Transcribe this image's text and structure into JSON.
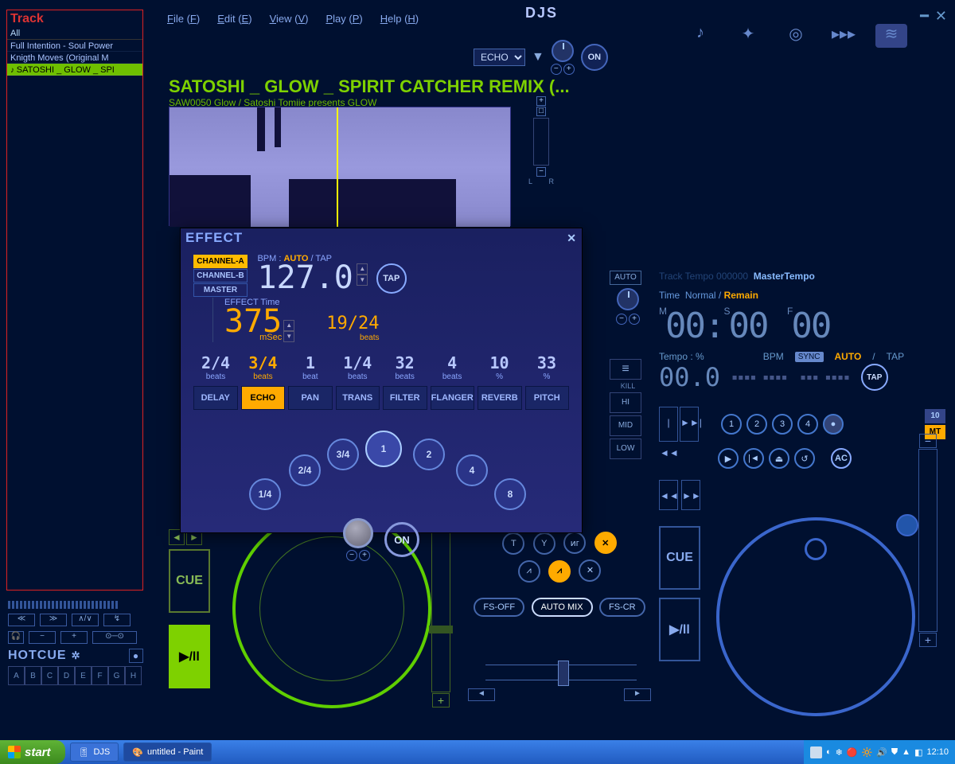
{
  "app_title": "DJS",
  "menus": {
    "file": "File (F)",
    "edit": "Edit (E)",
    "view": "View (V)",
    "play": "Play (P)",
    "help": "Help (H)"
  },
  "top_effect": {
    "selected": "ECHO",
    "on": "ON"
  },
  "track_panel": {
    "header": "Track",
    "filter": "All",
    "items": [
      "Full Intention - Soul Power",
      "Knigth Moves (Original M",
      "SATOSHI _ GLOW _ SPI"
    ],
    "selected_index": 2
  },
  "now_playing": {
    "title": "SATOSHI _ GLOW _ SPIRIT CATCHER REMIX (...",
    "subtitle": "SAW0050 Glow / Satoshi Tomiie presents GLOW"
  },
  "vol": {
    "l": "L",
    "r": "R"
  },
  "hotcue": {
    "label": "HOTCUE",
    "cells": [
      "A",
      "B",
      "C",
      "D",
      "E",
      "F",
      "G",
      "H"
    ]
  },
  "effect_modal": {
    "title": "EFFECT",
    "channels": [
      "CHANNEL-A",
      "CHANNEL-B",
      "MASTER"
    ],
    "channel_active": 0,
    "bpm_label_prefix": "BPM : ",
    "auto": "AUTO",
    "tap": "TAP",
    "bpm_value": "127.0",
    "time_label": "EFFECT Time",
    "time_value": "375",
    "time_unit": "mSec",
    "beats_ind": "19/24",
    "beats_unit": "beats",
    "beat_row_values": [
      "2/4",
      "3/4",
      "1",
      "1/4",
      "32",
      "4",
      "10",
      "33"
    ],
    "beat_row_units": [
      "beats",
      "beats",
      "beat",
      "beats",
      "beats",
      "beats",
      "%",
      "%"
    ],
    "beat_row_active": 1,
    "fx": [
      "DELAY",
      "ECHO",
      "PAN",
      "TRANS",
      "FILTER",
      "FLANGER",
      "REVERB",
      "PITCH"
    ],
    "fx_active": 1,
    "arc": [
      "1/4",
      "2/4",
      "3/4",
      "1",
      "2",
      "4",
      "8"
    ],
    "arc_selected": 3,
    "on": "ON"
  },
  "deck_a": {
    "cue": "CUE",
    "play": "▶/ll"
  },
  "mixer": {
    "row1": [
      "T",
      "Y",
      "ͷг",
      "✕"
    ],
    "row2": [
      "⩘",
      "⩘",
      "✕"
    ],
    "row2_active": 1,
    "fs_off": "FS-OFF",
    "automix": "AUTO MIX",
    "fs_cr": "FS-CR",
    "left_arrow": "◄",
    "right_arrow": "►"
  },
  "kill": {
    "auto": "AUTO",
    "wave_icon": "≡",
    "kill": "KILL",
    "hi": "HI",
    "mid": "MID",
    "low": "LOW"
  },
  "deck_b": {
    "header_prefix": "Track  Tempo  000000",
    "master_tempo": "MasterTempo",
    "time_label": "Time",
    "normal": "Normal",
    "remain": "Remain",
    "time_value": "00:00 00",
    "m": "M",
    "s": "S",
    "f": "F",
    "tempo_label": "Tempo : %",
    "tempo_value": "00.0",
    "bpm_label": "BPM",
    "sync": "SYNC",
    "auto": "AUTO",
    "tap": "TAP",
    "hot_nums": [
      "1",
      "2",
      "3",
      "4"
    ],
    "bank_10": "10",
    "bank_mt": "MT",
    "trans": [
      "▶",
      "|◄",
      "⏏",
      "↺"
    ],
    "ac": "AC",
    "seek": [
      "|◄◄",
      "►►|",
      "◄◄",
      "►►"
    ],
    "cue": "CUE",
    "play": "▶/ll"
  },
  "taskbar": {
    "start": "start",
    "items": [
      "DJS",
      "untitled - Paint"
    ],
    "active": 1,
    "clock": "12:10"
  }
}
